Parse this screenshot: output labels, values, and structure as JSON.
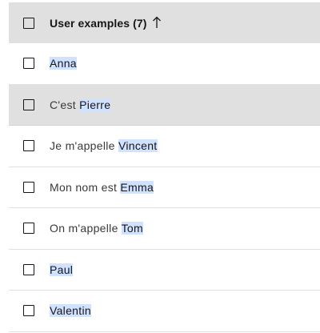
{
  "header": {
    "label": "User examples (7)",
    "sort_icon": "arrow-up-icon"
  },
  "rows": [
    {
      "prefix": "",
      "entity": "Anna"
    },
    {
      "prefix": "C'est ",
      "entity": "Pierre"
    },
    {
      "prefix": "Je m'appelle ",
      "entity": "Vincent"
    },
    {
      "prefix": "Mon nom est ",
      "entity": "Emma"
    },
    {
      "prefix": "On m'appelle ",
      "entity": "Tom"
    },
    {
      "prefix": "",
      "entity": "Paul"
    },
    {
      "prefix": "",
      "entity": "Valentin"
    }
  ],
  "colors": {
    "header_bg": "#e0e0e0",
    "hover_row_bg": "#e0e0e0",
    "entity_highlight": "#d0e2ff"
  }
}
